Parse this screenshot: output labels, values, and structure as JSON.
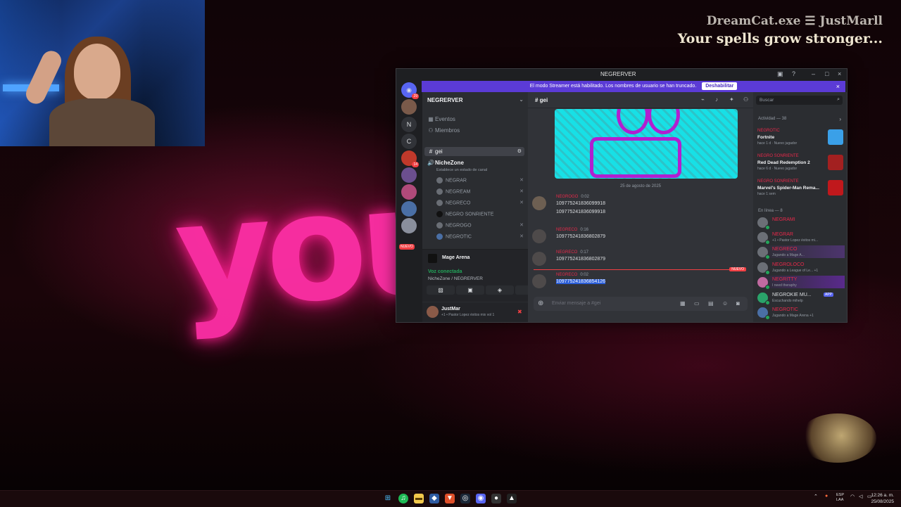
{
  "overlay": {
    "brand": "DreamCat.exe ☰ JustMarll",
    "tagline": "Your spells grow stronger...",
    "big_text": "you"
  },
  "discord": {
    "window_title": "NEGRERVER",
    "banner": {
      "text": "El modo Streamer está habilitado. Los nombres de usuario se han truncado.",
      "button": "Deshabilitar"
    },
    "guilds": {
      "letters": [
        "N",
        "C"
      ],
      "badge_top": "29",
      "badge_mid": "14",
      "nuevo": "NUEVO"
    },
    "server": {
      "name": "NEGRERVER",
      "events": "Eventos",
      "members": "Miembros",
      "text_channel": "gei",
      "voice_channel": "NicheZone",
      "voice_status": "Establece un estado de canal",
      "voice_users": [
        "NEGRAR",
        "NEGREAM",
        "NEGRECO",
        "NEGRO SONRIENTE",
        "NEGROGO",
        "NEGROTIC"
      ]
    },
    "arena": "Mage Arena",
    "voice": {
      "connected": "Voz conectada",
      "channel": "NicheZone / NEGRERVER"
    },
    "user": {
      "name": "JustMar",
      "status": "+1 • Pastor Lopez éxitos mix vol 1"
    },
    "chat": {
      "channel": "gei",
      "date_divider": "25 de agosto de 2025",
      "messages": [
        {
          "author": "NEGROGO",
          "time": "0:02",
          "lines": [
            "109775241836099918",
            "109775241836099918"
          ]
        },
        {
          "author": "NEGRECO",
          "time": "0:16",
          "lines": [
            "109775241836802879"
          ]
        },
        {
          "author": "NEGRECO",
          "time": "0:17",
          "lines": [
            "109775241836802879"
          ]
        },
        {
          "author": "NEGRECO",
          "time": "0:02",
          "lines": [
            "109775241836854126"
          ]
        }
      ],
      "new_badge": "NUEVO",
      "placeholder": "Enviar mensaje a #gei"
    },
    "members": {
      "search": "Buscar",
      "activity_header": "Actividad — 38",
      "activities": [
        {
          "name": "NEGROTIC",
          "game": "Fortnite",
          "meta": "hace 1 d · Nuevo jugador",
          "color": "#3aa0e8"
        },
        {
          "name": "NEGRO SONRIENTE",
          "game": "Red Dead Redemption 2",
          "meta": "hace 6 d · Nuevo jugador",
          "color": "#a32020"
        },
        {
          "name": "NEGRO SONRIENTE",
          "game": "Marvel's Spider-Man Rema...",
          "meta": "hace 1 sem",
          "color": "#c0181c"
        }
      ],
      "online_header": "En línea — 8",
      "online": [
        {
          "name": "NEGRAMI",
          "status": ""
        },
        {
          "name": "NEGRAR",
          "status": "+1 • Pastor Lopez éxitos mi..."
        },
        {
          "name": "NEGRECO",
          "status": "Jugando a Mage A..."
        },
        {
          "name": "NEGROLOCO",
          "status": "Jugando a League of Le... +1"
        },
        {
          "name": "NEGRITTY",
          "status": "I need theraphy"
        },
        {
          "name": "NEGROKIE MU...",
          "status": "Escuchando mihelp"
        },
        {
          "name": "NEGROTIC",
          "status": "Jugando a Mage Arena +1"
        }
      ],
      "app_badge": "APP"
    }
  },
  "taskbar": {
    "lang": "ESP",
    "lang2": "LAA",
    "time": "12:26 a. m.",
    "date": "25/08/2025"
  }
}
